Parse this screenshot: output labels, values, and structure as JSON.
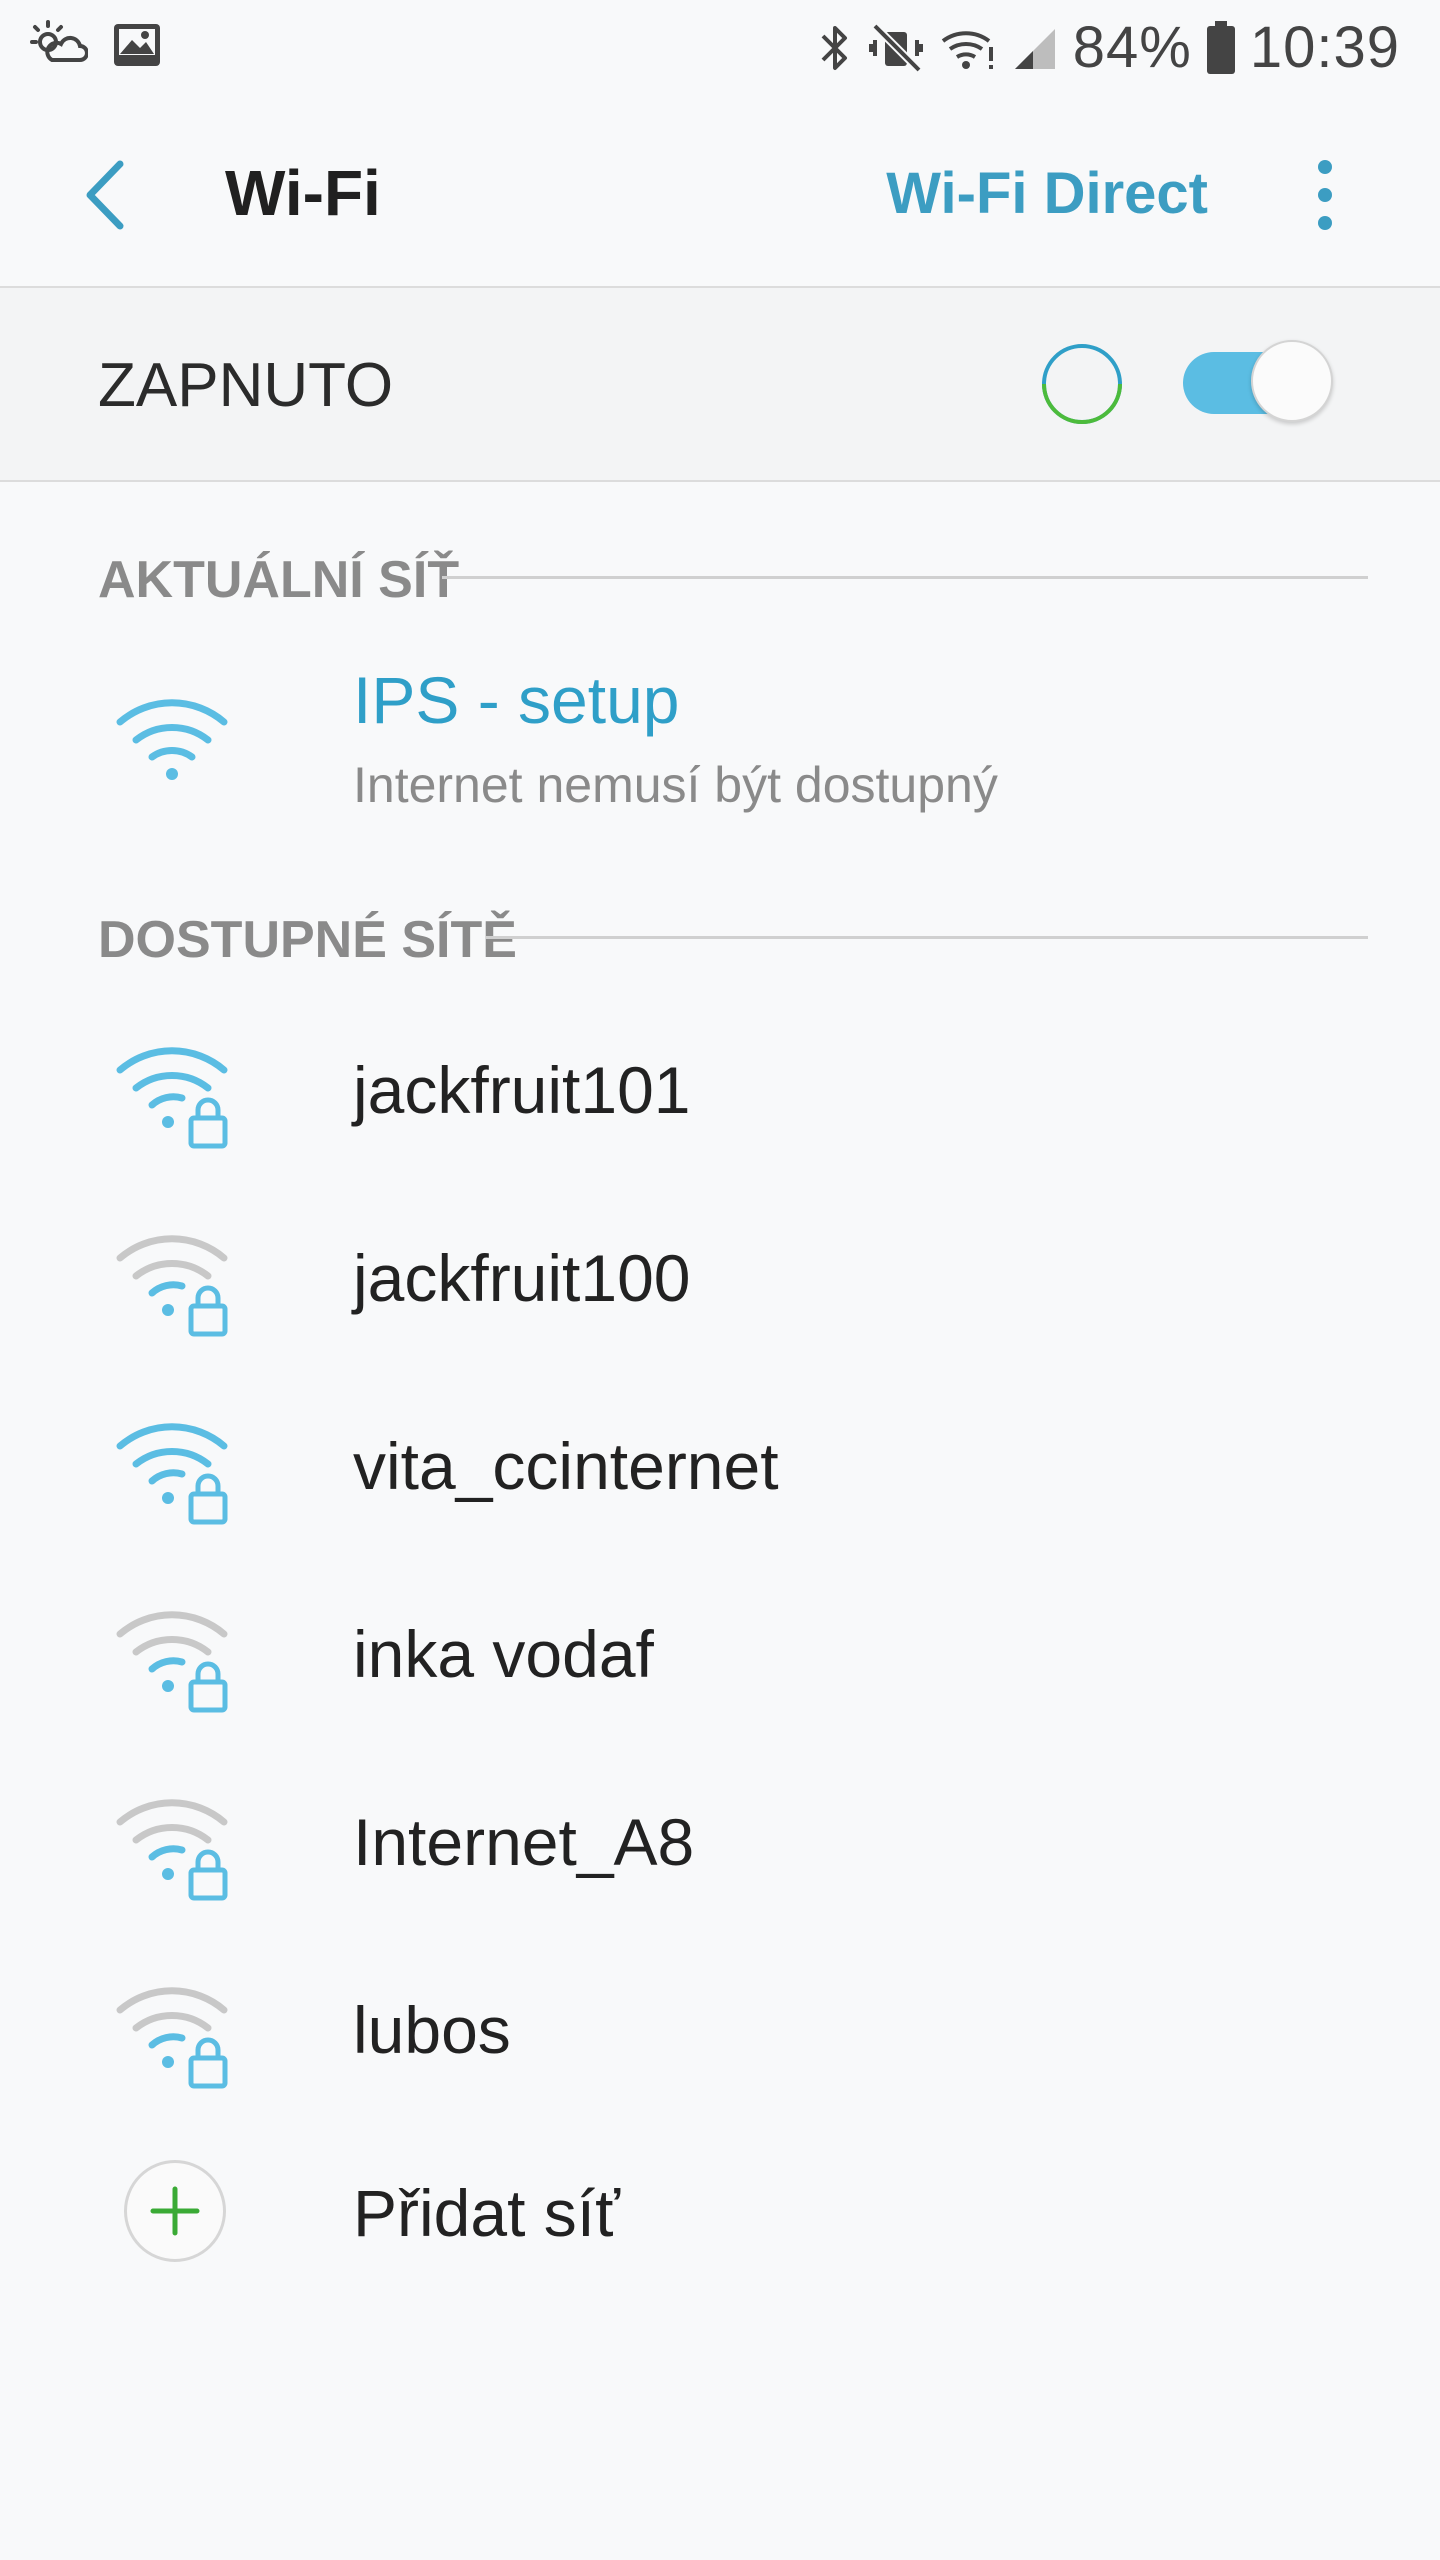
{
  "status_bar": {
    "battery_percent": "84%",
    "time": "10:39",
    "left_icons": [
      "weather-icon",
      "image-icon"
    ],
    "right_icons": [
      "bluetooth-icon",
      "mute-icon",
      "wifi-status-icon",
      "signal-icon",
      "battery-icon"
    ]
  },
  "app_bar": {
    "title": "Wi-Fi",
    "wifi_direct_label": "Wi-Fi Direct",
    "back_icon": "chevron-left-icon",
    "more_icon": "more-vertical-icon"
  },
  "master_switch": {
    "label": "ZAPNUTO",
    "enabled": true,
    "scanning": true
  },
  "current_network": {
    "section_title": "AKTUÁLNÍ SÍŤ",
    "name": "IPS - setup",
    "status": "Internet nemusí být dostupný",
    "icon": "wifi-icon"
  },
  "available_networks": {
    "section_title": "DOSTUPNÉ SÍTĚ",
    "items": [
      {
        "name": "jackfruit101",
        "strength": "strong",
        "secured": true
      },
      {
        "name": "jackfruit100",
        "strength": "weak",
        "secured": true
      },
      {
        "name": "vita_ccinternet",
        "strength": "strong",
        "secured": true
      },
      {
        "name": "inka vodaf",
        "strength": "weak",
        "secured": true
      },
      {
        "name": "Internet_A8",
        "strength": "weak",
        "secured": true
      },
      {
        "name": "lubos",
        "strength": "weak",
        "secured": true
      }
    ],
    "add_network_label": "Přidat síť"
  },
  "colors": {
    "accent": "#3c9dc2",
    "wifi_active": "#5bbde3",
    "wifi_weak": "#c8c8c8",
    "add_plus": "#3aaa35",
    "progress_green": "#4cbb3b",
    "progress_blue": "#2f9fc8"
  }
}
